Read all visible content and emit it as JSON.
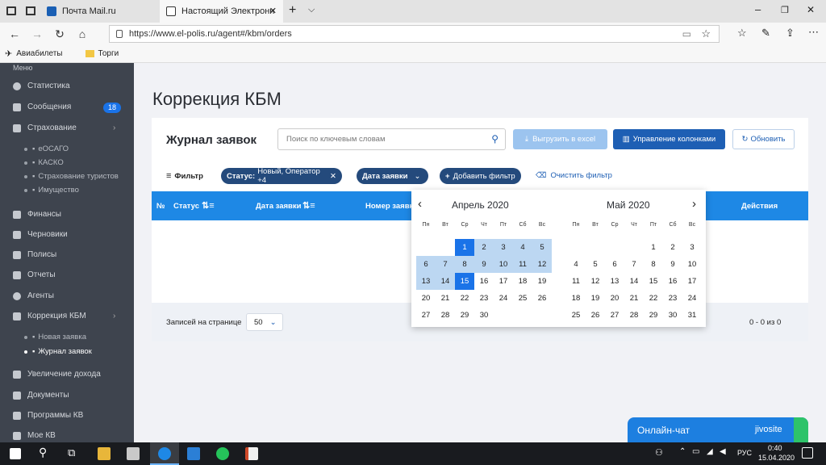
{
  "browser": {
    "tabs": [
      {
        "title": "Почта Mail.ru"
      },
      {
        "title": "Настоящий Электронн"
      }
    ],
    "url": "https://www.el-polis.ru/agent#/kbm/orders",
    "favorites": [
      "Авиабилеты",
      "Торги"
    ]
  },
  "sidebar": {
    "menu_label": "Меню",
    "items": [
      {
        "label": "Статистика"
      },
      {
        "label": "Сообщения",
        "badge": "18"
      },
      {
        "label": "Страхование"
      },
      {
        "label": "Финансы"
      },
      {
        "label": "Черновики"
      },
      {
        "label": "Полисы"
      },
      {
        "label": "Отчеты"
      },
      {
        "label": "Агенты"
      },
      {
        "label": "Коррекция КБМ"
      },
      {
        "label": "Увеличение дохода"
      },
      {
        "label": "Документы"
      },
      {
        "label": "Программы КВ"
      },
      {
        "label": "Мое КВ"
      }
    ],
    "insurance_sub": [
      "еОСАГО",
      "КАСКО",
      "Страхование туристов",
      "Имущество"
    ],
    "kbm_sub": [
      "Новая заявка",
      "Журнал заявок"
    ]
  },
  "main": {
    "page_title": "Коррекция КБМ",
    "journal_title": "Журнал заявок",
    "search_placeholder": "Поиск по ключевым словам",
    "export_button": "Выгрузить в excel",
    "columns_button": "Управление колонками",
    "refresh_button": "Обновить",
    "filter_label": "Фильтр",
    "status_chip_key": "Статус:",
    "status_chip_value": "Новый, Оператор +4",
    "date_chip": "Дата заявки",
    "add_filter": "Добавить фильтр",
    "clear_filter": "Очистить фильтр",
    "table_headers": [
      "№",
      "Статус",
      "Дата заявки",
      "Номер заявки",
      "Действия"
    ],
    "per_page_label": "Записей на странице",
    "per_page_value": "50",
    "pagination": "0 - 0 из 0"
  },
  "calendar": {
    "weekdays": [
      "Пн",
      "Вт",
      "Ср",
      "Чт",
      "Пт",
      "Сб",
      "Вс"
    ],
    "left_month": "Апрель 2020",
    "right_month": "Май 2020",
    "april": [
      [
        "",
        "",
        "1",
        "2",
        "3",
        "4",
        "5"
      ],
      [
        "6",
        "7",
        "8",
        "9",
        "10",
        "11",
        "12"
      ],
      [
        "13",
        "14",
        "15",
        "16",
        "17",
        "18",
        "19"
      ],
      [
        "20",
        "21",
        "22",
        "23",
        "24",
        "25",
        "26"
      ],
      [
        "27",
        "28",
        "29",
        "30",
        "",
        "",
        ""
      ]
    ],
    "may": [
      [
        "",
        "",
        "",
        "",
        "1",
        "2",
        "3"
      ],
      [
        "4",
        "5",
        "6",
        "7",
        "8",
        "9",
        "10"
      ],
      [
        "11",
        "12",
        "13",
        "14",
        "15",
        "16",
        "17"
      ],
      [
        "18",
        "19",
        "20",
        "21",
        "22",
        "23",
        "24"
      ],
      [
        "25",
        "26",
        "27",
        "28",
        "29",
        "30",
        "31"
      ]
    ],
    "range_start": "1",
    "range_end": "15"
  },
  "chat": {
    "label": "Онлайн-чат",
    "brand": "jivosite"
  },
  "taskbar": {
    "lang": "РУС",
    "time": "0:40",
    "date": "15.04.2020"
  },
  "colors": {
    "accent": "#1e88e5",
    "sidebar": "#3e444e",
    "chip": "#244a7c",
    "range": "#bcd7f2"
  }
}
